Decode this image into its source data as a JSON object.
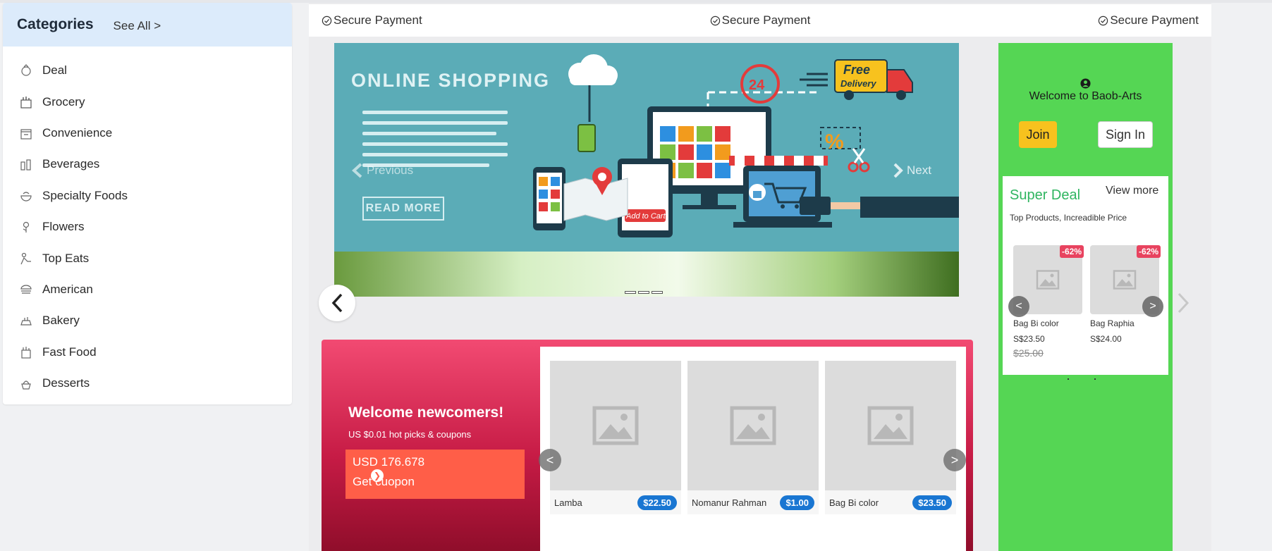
{
  "sidebar": {
    "title": "Categories",
    "see_all": "See All >",
    "items": [
      {
        "label": "Deal",
        "icon": "deal-icon"
      },
      {
        "label": "Grocery",
        "icon": "grocery-icon"
      },
      {
        "label": "Convenience",
        "icon": "convenience-icon"
      },
      {
        "label": "Beverages",
        "icon": "beverages-icon"
      },
      {
        "label": "Specialty Foods",
        "icon": "specialty-foods-icon"
      },
      {
        "label": "Flowers",
        "icon": "flowers-icon"
      },
      {
        "label": "Top Eats",
        "icon": "top-eats-icon"
      },
      {
        "label": "American",
        "icon": "american-icon"
      },
      {
        "label": "Bakery",
        "icon": "bakery-icon"
      },
      {
        "label": "Fast Food",
        "icon": "fast-food-icon"
      },
      {
        "label": "Desserts",
        "icon": "desserts-icon"
      }
    ]
  },
  "secure_bar": [
    "Secure Payment",
    "Secure Payment",
    "Secure Payment"
  ],
  "banner": {
    "title": "ONLINE  SHOPPING",
    "read_more": "READ MORE",
    "prev": "Previous",
    "next": "Next",
    "free_delivery_1": "Free",
    "free_delivery_2": "Delivery",
    "add_to_cart": "Add to Cart"
  },
  "newcomers": {
    "title": "Welcome newcomers!",
    "subtitle": "US $0.01 hot picks & coupons",
    "coupon_amount": "USD 176.678",
    "coupon_cta": "Get cuopon",
    "products": [
      {
        "name": "Lamba",
        "price": "$22.50"
      },
      {
        "name": "Nomanur Rahman",
        "price": "$1.00"
      },
      {
        "name": "Bag Bi color",
        "price": "$23.50"
      }
    ]
  },
  "right_panel": {
    "welcome": "Welcome to Baob-Arts",
    "join": "Join",
    "sign_in": "Sign In",
    "deal_title": "Super Deal",
    "view_more": "View more",
    "deal_subtitle": "Top Products, Increadible Price",
    "deals": [
      {
        "name": "Bag Bi color",
        "price": "S$23.50",
        "old_price": "$25.00",
        "discount": "-62%"
      },
      {
        "name": "Bag Raphia",
        "price": "S$24.00",
        "old_price": "",
        "discount": "-62%"
      }
    ]
  },
  "colors": {
    "sidebar_header": "#dcebfb",
    "banner_teal": "#5bacb7",
    "newcomer_pink": "#f24a72",
    "coupon_orange": "#ff5e48",
    "price_blue": "#1976d2",
    "panel_green": "#55d654",
    "join_yellow": "#f7c21e",
    "deal_title_green": "#2fb560",
    "badge_red": "#e8435f"
  }
}
